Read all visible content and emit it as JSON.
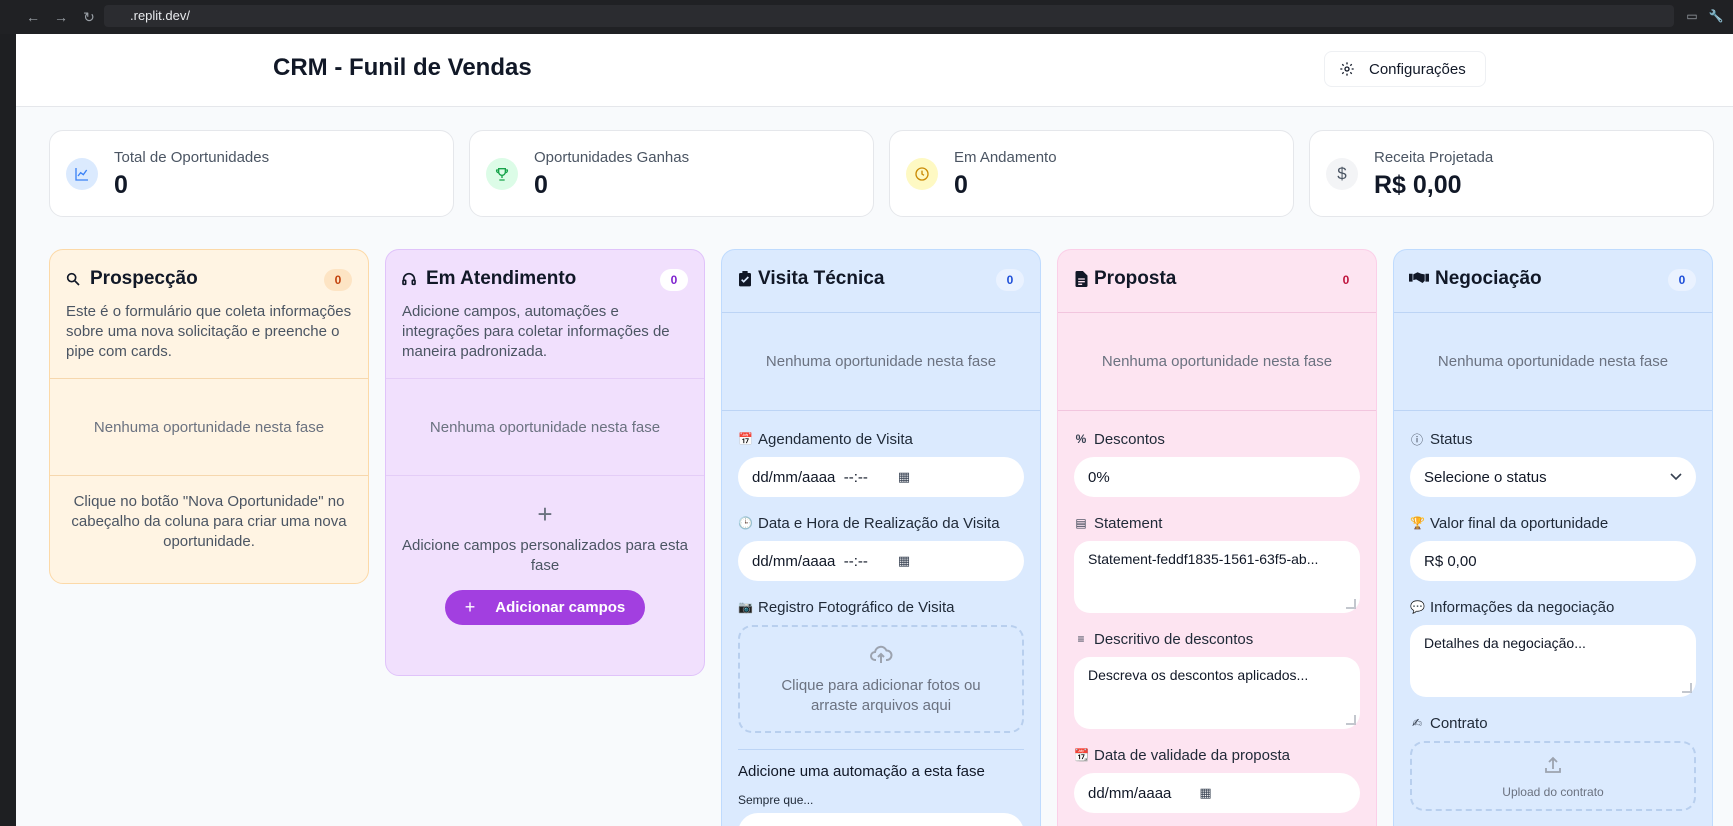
{
  "browser": {
    "url": ".replit.dev/"
  },
  "header": {
    "title": "CRM - Funil de Vendas",
    "config_label": "Configurações"
  },
  "stats": [
    {
      "label": "Total de Oportunidades",
      "value": "0",
      "icon": "chart-line-icon",
      "color": "#3b82f6",
      "bg": "#dbeafe"
    },
    {
      "label": "Oportunidades Ganhas",
      "value": "0",
      "icon": "trophy-icon",
      "color": "#16a34a",
      "bg": "#dcfce7"
    },
    {
      "label": "Em Andamento",
      "value": "0",
      "icon": "clock-icon",
      "color": "#ca8a04",
      "bg": "#fef9c3"
    },
    {
      "label": "Receita Projetada",
      "value": "R$ 0,00",
      "icon": "dollar-icon",
      "color": "#4b5563",
      "bg": "#f3f4f6"
    }
  ],
  "columns": {
    "prospeccao": {
      "title": "Prospecção",
      "count": "0",
      "description": "Este é o formulário que coleta informações sobre uma nova solicitação e preenche o pipe com cards.",
      "empty": "Nenhuma oportunidade nesta fase",
      "hint": "Clique no botão \"Nova Oportunidade\" no cabeçalho da coluna para criar uma nova oportunidade.",
      "bg": "#fff4e3",
      "border": "#fcd9a8",
      "count_color": "#c2410c"
    },
    "atendimento": {
      "title": "Em Atendimento",
      "count": "0",
      "description": "Adicione campos, automações e integrações para coletar informações de maneira padronizada.",
      "empty": "Nenhuma oportunidade nesta fase",
      "add_hint": "Adicione campos personalizados para esta fase",
      "add_button": "Adicionar campos",
      "bg": "#f1e0fd",
      "border": "#e0c3fa",
      "count_color": "#7e22ce"
    },
    "visita": {
      "title": "Visita Técnica",
      "count": "0",
      "empty": "Nenhuma oportunidade nesta fase",
      "fields": {
        "agendamento": {
          "label": "Agendamento de Visita",
          "value": "dd/mm/aaaa  --:--"
        },
        "realizacao": {
          "label": "Data e Hora de Realização da Visita",
          "value": "dd/mm/aaaa  --:--"
        },
        "registro": {
          "label": "Registro Fotográfico de Visita",
          "dropzone": "Clique para adicionar fotos ou arraste arquivos aqui"
        }
      },
      "automation_title": "Adicione uma automação a esta fase",
      "automation_when": "Sempre que...",
      "bg": "#dbeafe",
      "border": "#bfdbfe",
      "count_color": "#1d4ed8"
    },
    "proposta": {
      "title": "Proposta",
      "count": "0",
      "empty": "Nenhuma oportunidade nesta fase",
      "fields": {
        "descontos": {
          "label": "Descontos",
          "value": "0%"
        },
        "statement": {
          "label": "Statement",
          "value": "Statement-feddf1835-1561-63f5-ab..."
        },
        "descritivo": {
          "label": "Descritivo de descontos",
          "placeholder": "Descreva os descontos aplicados..."
        },
        "validade": {
          "label": "Data de validade da proposta",
          "value": "dd/mm/aaaa"
        }
      },
      "bg": "#fde4f1",
      "border": "#fbcfe8",
      "count_color": "#be123c"
    },
    "negociacao": {
      "title": "Negociação",
      "count": "0",
      "empty": "Nenhuma oportunidade nesta fase",
      "fields": {
        "status": {
          "label": "Status",
          "value": "Selecione o status"
        },
        "valor": {
          "label": "Valor final da oportunidade",
          "value": "R$ 0,00"
        },
        "info": {
          "label": "Informações da negociação",
          "placeholder": "Detalhes da negociação..."
        },
        "contrato": {
          "label": "Contrato",
          "dropzone": "Upload do contrato"
        }
      },
      "bg": "#dbeafe",
      "border": "#bfdbfe",
      "count_color": "#1d4ed8"
    }
  }
}
